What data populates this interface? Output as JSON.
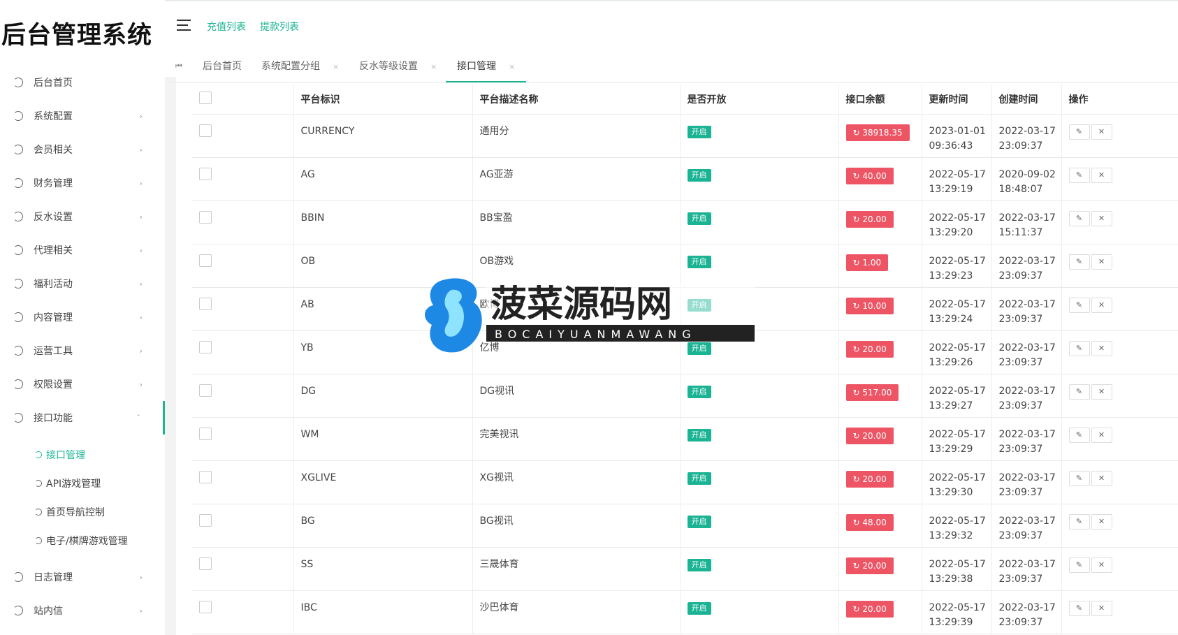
{
  "app": {
    "title": "后台管理系统"
  },
  "sidebar": {
    "items": [
      {
        "label": "后台首页",
        "arrow": ""
      },
      {
        "label": "系统配置",
        "arrow": "›"
      },
      {
        "label": "会员相关",
        "arrow": "›"
      },
      {
        "label": "财务管理",
        "arrow": "›"
      },
      {
        "label": "反水设置",
        "arrow": "›"
      },
      {
        "label": "代理相关",
        "arrow": "›"
      },
      {
        "label": "福利活动",
        "arrow": "›"
      },
      {
        "label": "内容管理",
        "arrow": "›"
      },
      {
        "label": "运营工具",
        "arrow": "›"
      },
      {
        "label": "权限设置",
        "arrow": "›"
      },
      {
        "label": "接口功能",
        "arrow": "ˇ"
      }
    ],
    "subitems": [
      "接口管理",
      "API游戏管理",
      "首页导航控制",
      "电子/棋牌游戏管理"
    ],
    "bottom_items": [
      {
        "label": "日志管理",
        "arrow": "›"
      },
      {
        "label": "站内信",
        "arrow": "›"
      }
    ]
  },
  "header": {
    "links": [
      "充值列表",
      "提款列表"
    ]
  },
  "tabs": [
    {
      "label": "后台首页",
      "close": ""
    },
    {
      "label": "系统配置分组",
      "close": "×"
    },
    {
      "label": "反水等级设置",
      "close": "×"
    },
    {
      "label": "接口管理",
      "close": "×"
    }
  ],
  "table": {
    "columns": [
      "平台标识",
      "平台描述名称",
      "是否开放",
      "接口余额",
      "更新时间",
      "创建时间",
      "操作"
    ],
    "status_label": "开启",
    "refresh_icon": "↻",
    "rows": [
      {
        "code": "CURRENCY",
        "name": "通用分",
        "balance": "38918.35",
        "updated": [
          "2023-01-01",
          "09:36:43"
        ],
        "created": [
          "2022-03-17",
          "23:09:37"
        ]
      },
      {
        "code": "AG",
        "name": "AG亚游",
        "balance": "40.00",
        "updated": [
          "2022-05-17",
          "13:29:19"
        ],
        "created": [
          "2020-09-02",
          "18:48:07"
        ]
      },
      {
        "code": "BBIN",
        "name": "BB宝盈",
        "balance": "20.00",
        "updated": [
          "2022-05-17",
          "13:29:20"
        ],
        "created": [
          "2022-03-17",
          "15:11:37"
        ]
      },
      {
        "code": "OB",
        "name": "OB游戏",
        "balance": "1.00",
        "updated": [
          "2022-05-17",
          "13:29:23"
        ],
        "created": [
          "2022-03-17",
          "23:09:37"
        ]
      },
      {
        "code": "AB",
        "name": "欧博",
        "balance": "10.00",
        "updated": [
          "2022-05-17",
          "13:29:24"
        ],
        "created": [
          "2022-03-17",
          "23:09:37"
        ]
      },
      {
        "code": "YB",
        "name": "亿博",
        "balance": "20.00",
        "updated": [
          "2022-05-17",
          "13:29:26"
        ],
        "created": [
          "2022-03-17",
          "23:09:37"
        ]
      },
      {
        "code": "DG",
        "name": "DG视讯",
        "balance": "517.00",
        "updated": [
          "2022-05-17",
          "13:29:27"
        ],
        "created": [
          "2022-03-17",
          "23:09:37"
        ]
      },
      {
        "code": "WM",
        "name": "完美视讯",
        "balance": "20.00",
        "updated": [
          "2022-05-17",
          "13:29:29"
        ],
        "created": [
          "2022-03-17",
          "23:09:37"
        ]
      },
      {
        "code": "XGLIVE",
        "name": "XG视讯",
        "balance": "20.00",
        "updated": [
          "2022-05-17",
          "13:29:30"
        ],
        "created": [
          "2022-03-17",
          "23:09:37"
        ]
      },
      {
        "code": "BG",
        "name": "BG视讯",
        "balance": "48.00",
        "updated": [
          "2022-05-17",
          "13:29:32"
        ],
        "created": [
          "2022-03-17",
          "23:09:37"
        ]
      },
      {
        "code": "SS",
        "name": "三晟体育",
        "balance": "20.00",
        "updated": [
          "2022-05-17",
          "13:29:38"
        ],
        "created": [
          "2022-03-17",
          "23:09:37"
        ]
      },
      {
        "code": "IBC",
        "name": "沙巴体育",
        "balance": "20.00",
        "updated": [
          "2022-05-17",
          "13:29:39"
        ],
        "created": [
          "2022-03-17",
          "23:09:37"
        ]
      }
    ]
  },
  "watermark": {
    "title": "菠菜源码网",
    "subtitle": "BOCAIYUANMAWANG"
  },
  "colors": {
    "accent": "#1ab394",
    "danger": "#ed5565",
    "watermark_dark": "#222222",
    "watermark_blue": "#1e88e5"
  }
}
